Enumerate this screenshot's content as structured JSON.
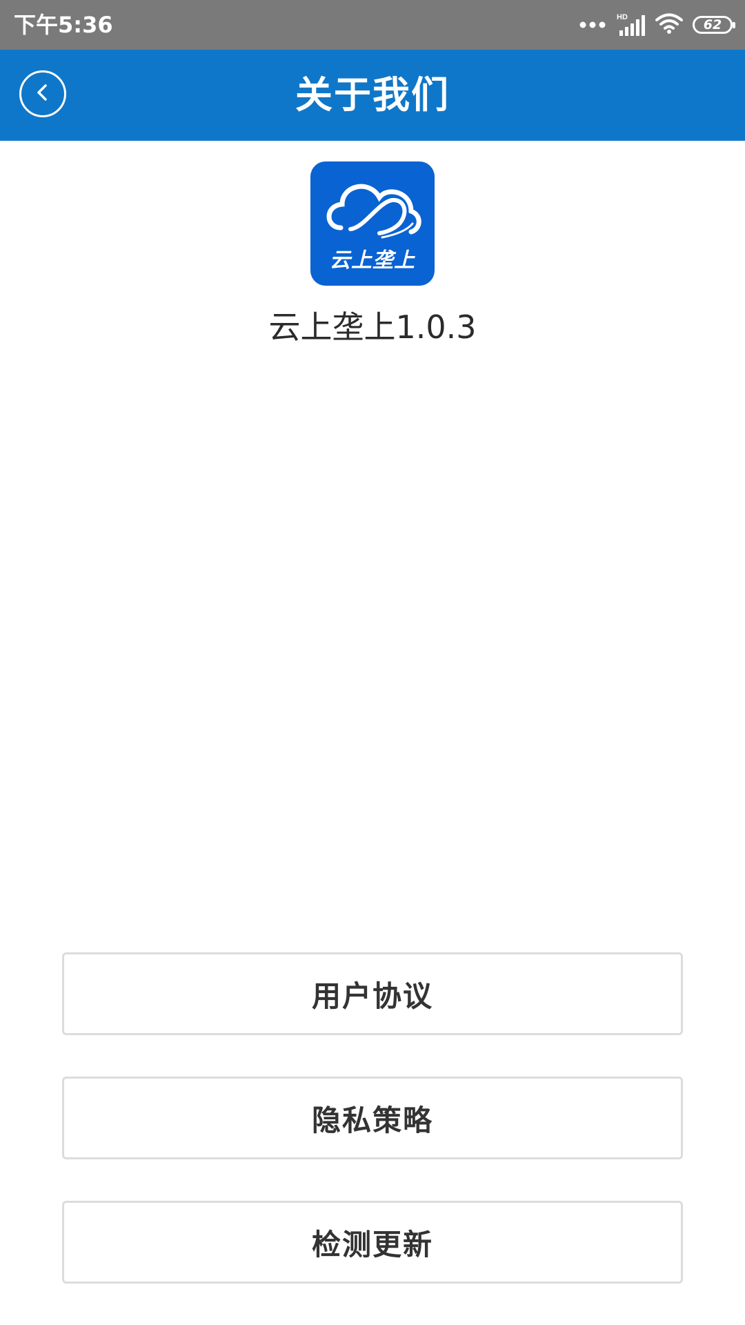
{
  "status_bar": {
    "time": "下午5:36",
    "network_badge": "HD",
    "battery_level": "62",
    "icons": [
      "more-dots-icon",
      "cellular-signal-icon",
      "wifi-icon",
      "battery-icon"
    ]
  },
  "header": {
    "title": "关于我们",
    "background_color": "#0f77c9",
    "back_icon": "chevron-left-icon"
  },
  "app_info": {
    "logo_text": "云上垄上",
    "version_label": "云上垄上1.0.3",
    "logo_color": "#0a63d3"
  },
  "actions": {
    "user_agreement": "用户协议",
    "privacy_policy": "隐私策略",
    "check_update": "检测更新"
  }
}
